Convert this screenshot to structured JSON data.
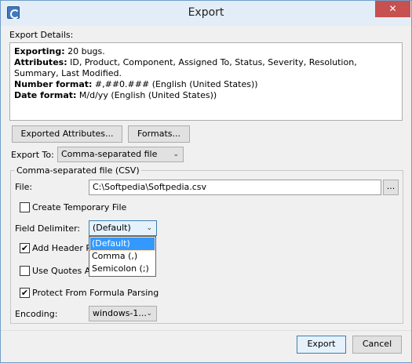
{
  "window": {
    "title": "Export",
    "close_glyph": "✕",
    "app_icon": "app-icon"
  },
  "details": {
    "label": "Export Details:",
    "exporting_key": "Exporting:",
    "exporting_value": " 20 bugs.",
    "attributes_key": "Attributes:",
    "attributes_value": " ID, Product, Component, Assigned To, Status, Severity, Resolution, Summary, Last Modified.",
    "number_format_key": "Number format:",
    "number_format_value": " #,##0.### (English (United States))",
    "date_format_key": "Date format:",
    "date_format_value": " M/d/yy (English (United States))"
  },
  "buttons": {
    "exported_attributes": "Exported Attributes...",
    "formats": "Formats...",
    "browse": "...",
    "export": "Export",
    "cancel": "Cancel"
  },
  "export_to": {
    "label": "Export To:",
    "value": "Comma-separated file (CSV)"
  },
  "group": {
    "title": "Comma-separated file (CSV)",
    "file_label": "File:",
    "file_value": "C:\\Softpedia\\Softpedia.csv",
    "create_temp_label": "Create Temporary File",
    "create_temp_checked": false,
    "field_delimiter_label": "Field Delimiter:",
    "field_delimiter_value": "(Default)",
    "delimiter_options": [
      "(Default)",
      "Comma (,)",
      "Semicolon (;)"
    ],
    "add_header_label": "Add Header Ro",
    "add_header_checked": true,
    "use_quotes_label": "Use Quotes Alv",
    "use_quotes_checked": false,
    "protect_label": "Protect From Formula Parsing",
    "protect_checked": true,
    "encoding_label": "Encoding:",
    "encoding_value": "windows-1..."
  },
  "check_glyph": "✔",
  "arrow_glyph": "⌄"
}
